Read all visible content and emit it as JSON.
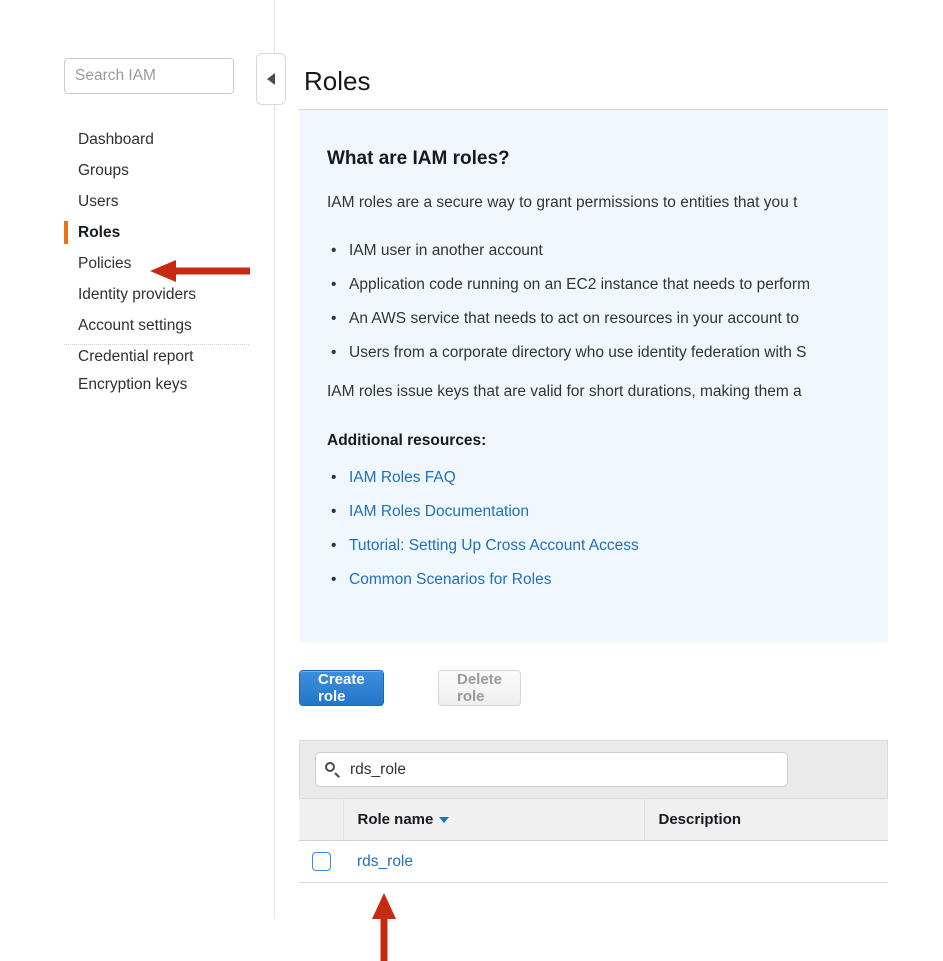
{
  "sidebar": {
    "search": {
      "placeholder": "Search IAM",
      "value": ""
    },
    "items": [
      {
        "label": "Dashboard",
        "active": false
      },
      {
        "label": "Groups",
        "active": false
      },
      {
        "label": "Users",
        "active": false
      },
      {
        "label": "Roles",
        "active": true
      },
      {
        "label": "Policies",
        "active": false
      },
      {
        "label": "Identity providers",
        "active": false
      },
      {
        "label": "Account settings",
        "active": false
      },
      {
        "label": "Credential report",
        "active": false
      }
    ],
    "items_bottom": [
      {
        "label": "Encryption keys",
        "active": false
      }
    ],
    "collapse_icon": "chevron-left-icon"
  },
  "main": {
    "page_title": "Roles",
    "info_panel": {
      "heading": "What are IAM roles?",
      "intro": "IAM roles are a secure way to grant permissions to entities that you t",
      "bullets": [
        "IAM user in another account",
        "Application code running on an EC2 instance that needs to perform",
        "An AWS service that needs to act on resources in your account to",
        "Users from a corporate directory who use identity federation with S"
      ],
      "closing": "IAM roles issue keys that are valid for short durations, making them a",
      "resources_heading": "Additional resources:",
      "resource_links": [
        "IAM Roles FAQ",
        "IAM Roles Documentation",
        "Tutorial: Setting Up Cross Account Access",
        "Common Scenarios for Roles"
      ]
    },
    "buttons": {
      "create_role": "Create role",
      "delete_role": "Delete role"
    },
    "table": {
      "search": {
        "value": "rds_role",
        "placeholder": "",
        "icon": "search-icon"
      },
      "columns": [
        {
          "label": "Role name",
          "sorted": true,
          "sort_icon": "caret-down-icon"
        },
        {
          "label": "Description",
          "sorted": false
        }
      ],
      "rows": [
        {
          "checked": false,
          "role_name": "rds_role",
          "description": ""
        }
      ]
    }
  },
  "annotations": {
    "color": "#c62a10",
    "arrows": [
      {
        "name": "arrow-pointing-to-roles-nav",
        "direction": "left"
      },
      {
        "name": "arrow-pointing-to-role-link",
        "direction": "up"
      }
    ]
  },
  "colors": {
    "accent_orange": "#ec7211",
    "link_blue": "#1f6fbf",
    "primary_button": "#2476c9",
    "info_panel_bg": "#f1f8fd",
    "annotation_red": "#c62a10"
  }
}
